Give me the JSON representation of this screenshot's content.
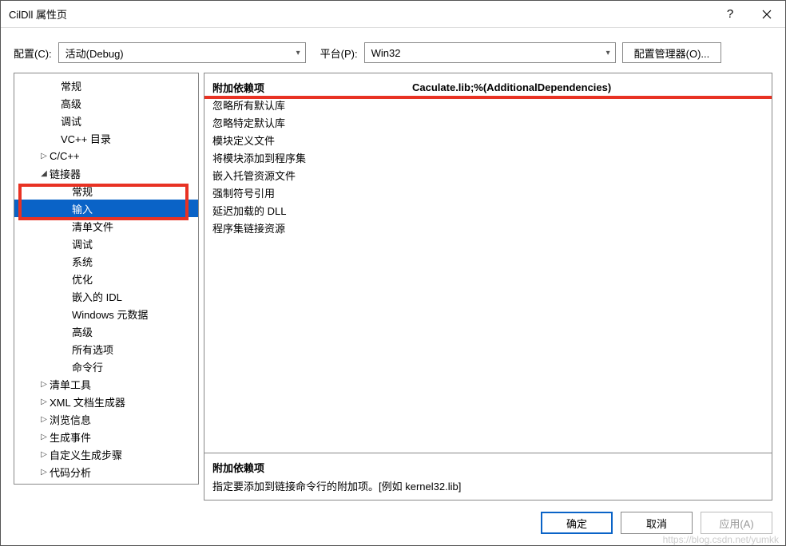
{
  "window": {
    "title": "CilDll 属性页"
  },
  "configRow": {
    "configLabel": "配置(C):",
    "configValue": "活动(Debug)",
    "platformLabel": "平台(P):",
    "platformValue": "Win32",
    "managerBtn": "配置管理器(O)..."
  },
  "tree": [
    {
      "label": "常规",
      "indent": 44,
      "arrow": ""
    },
    {
      "label": "高级",
      "indent": 44,
      "arrow": ""
    },
    {
      "label": "调试",
      "indent": 44,
      "arrow": ""
    },
    {
      "label": "VC++ 目录",
      "indent": 44,
      "arrow": ""
    },
    {
      "label": "C/C++",
      "indent": 30,
      "arrow": "▷"
    },
    {
      "label": "链接器",
      "indent": 30,
      "arrow": "◢"
    },
    {
      "label": "常规",
      "indent": 58,
      "arrow": ""
    },
    {
      "label": "输入",
      "indent": 58,
      "arrow": "",
      "selected": true
    },
    {
      "label": "清单文件",
      "indent": 58,
      "arrow": ""
    },
    {
      "label": "调试",
      "indent": 58,
      "arrow": ""
    },
    {
      "label": "系统",
      "indent": 58,
      "arrow": ""
    },
    {
      "label": "优化",
      "indent": 58,
      "arrow": ""
    },
    {
      "label": "嵌入的 IDL",
      "indent": 58,
      "arrow": ""
    },
    {
      "label": "Windows 元数据",
      "indent": 58,
      "arrow": ""
    },
    {
      "label": "高级",
      "indent": 58,
      "arrow": ""
    },
    {
      "label": "所有选项",
      "indent": 58,
      "arrow": ""
    },
    {
      "label": "命令行",
      "indent": 58,
      "arrow": ""
    },
    {
      "label": "清单工具",
      "indent": 30,
      "arrow": "▷"
    },
    {
      "label": "XML 文档生成器",
      "indent": 30,
      "arrow": "▷"
    },
    {
      "label": "浏览信息",
      "indent": 30,
      "arrow": "▷"
    },
    {
      "label": "生成事件",
      "indent": 30,
      "arrow": "▷"
    },
    {
      "label": "自定义生成步骤",
      "indent": 30,
      "arrow": "▷"
    },
    {
      "label": "代码分析",
      "indent": 30,
      "arrow": "▷"
    }
  ],
  "properties": [
    {
      "label": "附加依赖项",
      "value": "Caculate.lib;%(AdditionalDependencies)",
      "highlighted": true
    },
    {
      "label": "忽略所有默认库",
      "value": ""
    },
    {
      "label": "忽略特定默认库",
      "value": ""
    },
    {
      "label": "模块定义文件",
      "value": ""
    },
    {
      "label": "将模块添加到程序集",
      "value": ""
    },
    {
      "label": "嵌入托管资源文件",
      "value": ""
    },
    {
      "label": "强制符号引用",
      "value": ""
    },
    {
      "label": "延迟加载的 DLL",
      "value": ""
    },
    {
      "label": "程序集链接资源",
      "value": ""
    }
  ],
  "description": {
    "title": "附加依赖项",
    "text": "指定要添加到链接命令行的附加项。[例如 kernel32.lib]"
  },
  "buttons": {
    "ok": "确定",
    "cancel": "取消",
    "apply": "应用(A)"
  },
  "watermark": "https://blog.csdn.net/yumkk"
}
